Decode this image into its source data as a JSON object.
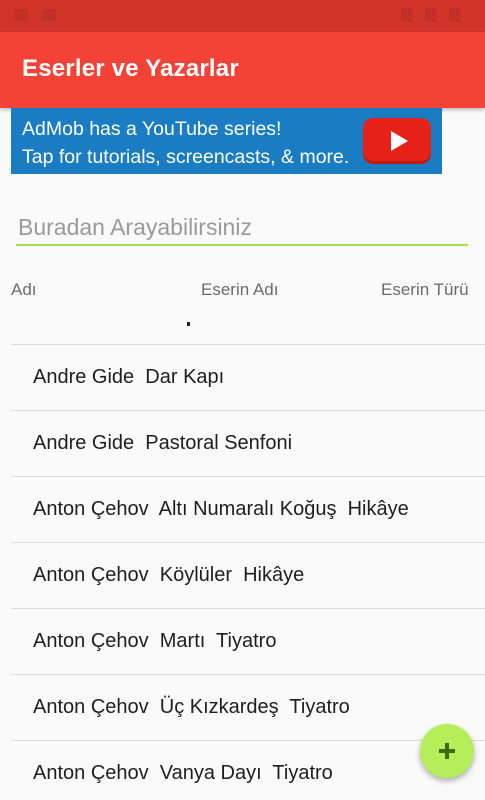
{
  "status_bar": {
    "icons": [
      "notification-icon",
      "notification-icon",
      "wifi-icon",
      "signal-icon",
      "battery-icon"
    ]
  },
  "app_bar": {
    "title": "Eserler ve Yazarlar",
    "color": "#f44336"
  },
  "ad_banner": {
    "line1": "AdMob has a YouTube series!",
    "line2": "Tap for tutorials, screencasts, & more.",
    "icon": "youtube-play-icon",
    "color": "#1a7dc4"
  },
  "search": {
    "value": "",
    "placeholder": "Buradan Arayabilirsiniz",
    "underline_color": "#a6e24f"
  },
  "table": {
    "headers": [
      "Adı",
      "Eserin Adı",
      "Eserin Türü"
    ],
    "rows": [
      "Andre Gide  Dar Kapı",
      "Andre Gide  Pastoral Senfoni",
      "Anton Çehov  Altı Numaralı Koğuş  Hikâye",
      "Anton Çehov  Köylüler  Hikâye",
      "Anton Çehov  Martı  Tiyatro",
      "Anton Çehov  Üç Kızkardeş  Tiyatro",
      "Anton Çehov  Vanya Dayı  Tiyatro"
    ]
  },
  "fab": {
    "icon": "plus-icon",
    "color": "#b5ee58"
  }
}
